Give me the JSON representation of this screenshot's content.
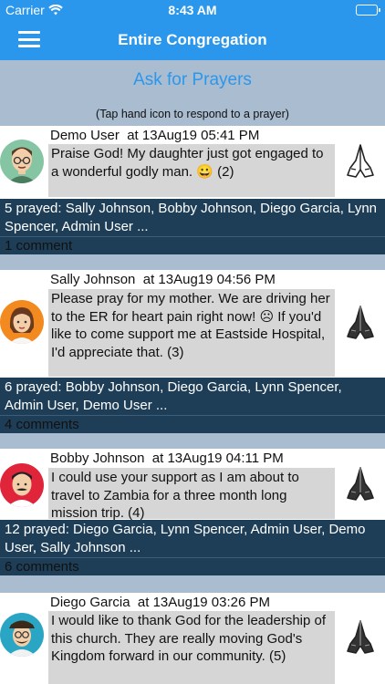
{
  "status": {
    "carrier": "Carrier",
    "time": "8:43 AM"
  },
  "nav": {
    "title": "Entire Congregation"
  },
  "ask_label": "Ask for Prayers",
  "hint": "(Tap hand icon to respond to a prayer)",
  "posts": [
    {
      "author": "Demo User",
      "timestamp": "at 13Aug19 05:41 PM",
      "message": "Praise God! My daughter just got engaged to a wonderful godly man. 😀 (2)",
      "prayed": "5 prayed: Sally Johnson, Bobby Johnson, Diego Garcia, Lynn Spencer, Admin User ...",
      "comments": "1 comment",
      "hand_state": "outline",
      "avatar_icon": "man-glasses-avatar-icon"
    },
    {
      "author": "Sally Johnson",
      "timestamp": "at 13Aug19 04:56 PM",
      "message": "Please pray for my mother. We are driving her to the ER for heart pain right now! ☹ If you'd like to come support me at Eastside Hospital, I'd appreciate that. (3)",
      "prayed": "6 prayed: Bobby Johnson, Diego Garcia, Lynn Spencer, Admin User, Demo User ...",
      "comments": "4 comments",
      "hand_state": "filled",
      "avatar_icon": "woman-avatar-icon"
    },
    {
      "author": "Bobby Johnson",
      "timestamp": "at 13Aug19 04:11 PM",
      "message": "I could use your support as I am about to travel to Zambia for a three month long mission trip. (4)",
      "prayed": "12 prayed: Diego Garcia, Lynn Spencer, Admin User, Demo User, Sally Johnson ...",
      "comments": "6 comments",
      "hand_state": "filled",
      "avatar_icon": "man-mustache-avatar-icon"
    },
    {
      "author": "Diego Garcia",
      "timestamp": "at 13Aug19 03:26 PM",
      "message": "I would like to thank God for the leadership of this church. They are really moving God's Kingdom forward in our community. (5)",
      "prayed": "",
      "comments": "",
      "hand_state": "filled",
      "avatar_icon": "man-hat-avatar-icon"
    }
  ]
}
